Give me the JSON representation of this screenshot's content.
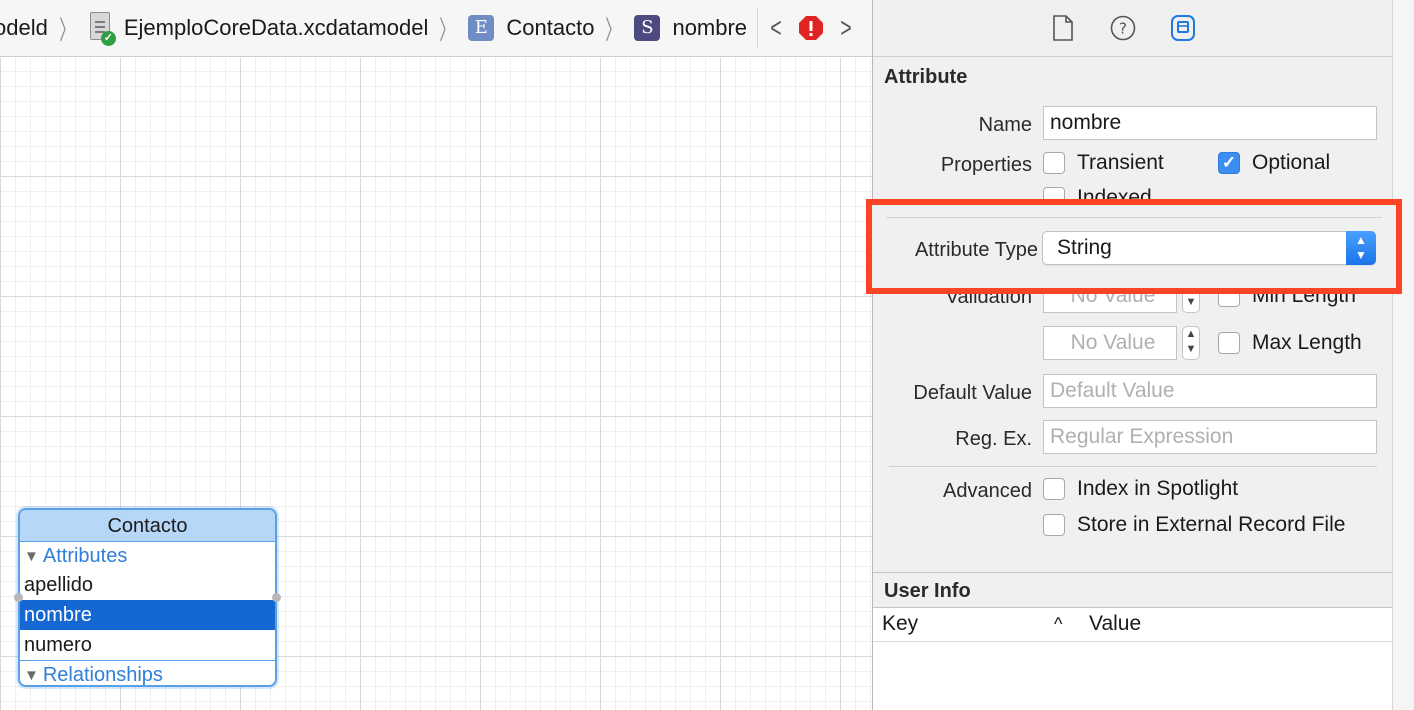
{
  "jumpbar": {
    "crumb_partial": "odeld",
    "model_file": "EjemploCoreData.xcdatamodel",
    "entity_badge": "E",
    "entity_name": "Contacto",
    "attribute_badge": "S",
    "attribute_name": "nombre",
    "prev_arrow": "<",
    "next_arrow": ">"
  },
  "entity_box": {
    "title": "Contacto",
    "attributes_label": "Attributes",
    "attributes": [
      "apellido",
      "nombre",
      "numero"
    ],
    "selected_attribute": "nombre",
    "relationships_label": "Relationships"
  },
  "inspector": {
    "tabs": [
      "file-inspector-icon",
      "quick-help-icon",
      "data-model-inspector-icon"
    ],
    "attribute_section": {
      "title": "Attribute",
      "name_label": "Name",
      "name_value": "nombre",
      "properties_label": "Properties",
      "transient_label": "Transient",
      "transient_checked": false,
      "optional_label": "Optional",
      "optional_checked": true,
      "indexed_label": "Indexed",
      "indexed_checked": false,
      "attribute_type_label": "Attribute Type",
      "attribute_type_value": "String",
      "validation_label": "Validation",
      "min_value_placeholder": "No Value",
      "min_length_label": "Min Length",
      "max_value_placeholder": "No Value",
      "max_length_label": "Max Length",
      "default_value_label": "Default Value",
      "default_value_placeholder": "Default Value",
      "regex_label": "Reg. Ex.",
      "regex_placeholder": "Regular Expression",
      "advanced_label": "Advanced",
      "spotlight_label": "Index in Spotlight",
      "external_record_label": "Store in External Record File"
    },
    "user_info_section": {
      "title": "User Info",
      "key_header": "Key",
      "value_header": "Value",
      "sort_glyph": "^"
    }
  },
  "colors": {
    "highlight": "#fb4325",
    "accent": "#3c8ff0",
    "selection": "#1568d2",
    "entity_title_bg": "#b6d7f8"
  }
}
